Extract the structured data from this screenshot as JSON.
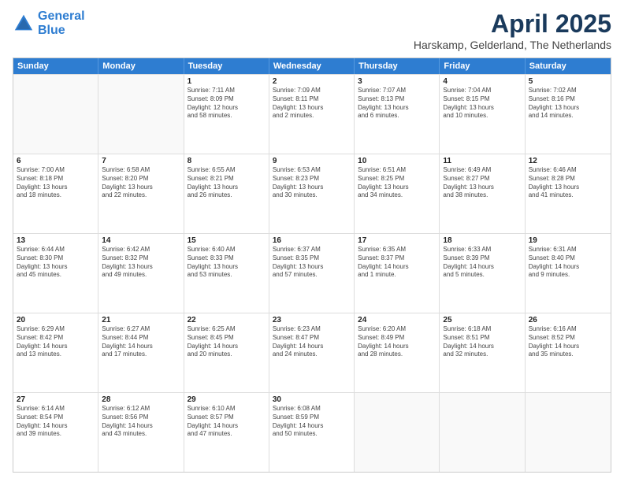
{
  "logo": {
    "line1": "General",
    "line2": "Blue"
  },
  "title": "April 2025",
  "subtitle": "Harskamp, Gelderland, The Netherlands",
  "header_days": [
    "Sunday",
    "Monday",
    "Tuesday",
    "Wednesday",
    "Thursday",
    "Friday",
    "Saturday"
  ],
  "weeks": [
    [
      {
        "day": "",
        "lines": []
      },
      {
        "day": "",
        "lines": []
      },
      {
        "day": "1",
        "lines": [
          "Sunrise: 7:11 AM",
          "Sunset: 8:09 PM",
          "Daylight: 12 hours",
          "and 58 minutes."
        ]
      },
      {
        "day": "2",
        "lines": [
          "Sunrise: 7:09 AM",
          "Sunset: 8:11 PM",
          "Daylight: 13 hours",
          "and 2 minutes."
        ]
      },
      {
        "day": "3",
        "lines": [
          "Sunrise: 7:07 AM",
          "Sunset: 8:13 PM",
          "Daylight: 13 hours",
          "and 6 minutes."
        ]
      },
      {
        "day": "4",
        "lines": [
          "Sunrise: 7:04 AM",
          "Sunset: 8:15 PM",
          "Daylight: 13 hours",
          "and 10 minutes."
        ]
      },
      {
        "day": "5",
        "lines": [
          "Sunrise: 7:02 AM",
          "Sunset: 8:16 PM",
          "Daylight: 13 hours",
          "and 14 minutes."
        ]
      }
    ],
    [
      {
        "day": "6",
        "lines": [
          "Sunrise: 7:00 AM",
          "Sunset: 8:18 PM",
          "Daylight: 13 hours",
          "and 18 minutes."
        ]
      },
      {
        "day": "7",
        "lines": [
          "Sunrise: 6:58 AM",
          "Sunset: 8:20 PM",
          "Daylight: 13 hours",
          "and 22 minutes."
        ]
      },
      {
        "day": "8",
        "lines": [
          "Sunrise: 6:55 AM",
          "Sunset: 8:21 PM",
          "Daylight: 13 hours",
          "and 26 minutes."
        ]
      },
      {
        "day": "9",
        "lines": [
          "Sunrise: 6:53 AM",
          "Sunset: 8:23 PM",
          "Daylight: 13 hours",
          "and 30 minutes."
        ]
      },
      {
        "day": "10",
        "lines": [
          "Sunrise: 6:51 AM",
          "Sunset: 8:25 PM",
          "Daylight: 13 hours",
          "and 34 minutes."
        ]
      },
      {
        "day": "11",
        "lines": [
          "Sunrise: 6:49 AM",
          "Sunset: 8:27 PM",
          "Daylight: 13 hours",
          "and 38 minutes."
        ]
      },
      {
        "day": "12",
        "lines": [
          "Sunrise: 6:46 AM",
          "Sunset: 8:28 PM",
          "Daylight: 13 hours",
          "and 41 minutes."
        ]
      }
    ],
    [
      {
        "day": "13",
        "lines": [
          "Sunrise: 6:44 AM",
          "Sunset: 8:30 PM",
          "Daylight: 13 hours",
          "and 45 minutes."
        ]
      },
      {
        "day": "14",
        "lines": [
          "Sunrise: 6:42 AM",
          "Sunset: 8:32 PM",
          "Daylight: 13 hours",
          "and 49 minutes."
        ]
      },
      {
        "day": "15",
        "lines": [
          "Sunrise: 6:40 AM",
          "Sunset: 8:33 PM",
          "Daylight: 13 hours",
          "and 53 minutes."
        ]
      },
      {
        "day": "16",
        "lines": [
          "Sunrise: 6:37 AM",
          "Sunset: 8:35 PM",
          "Daylight: 13 hours",
          "and 57 minutes."
        ]
      },
      {
        "day": "17",
        "lines": [
          "Sunrise: 6:35 AM",
          "Sunset: 8:37 PM",
          "Daylight: 14 hours",
          "and 1 minute."
        ]
      },
      {
        "day": "18",
        "lines": [
          "Sunrise: 6:33 AM",
          "Sunset: 8:39 PM",
          "Daylight: 14 hours",
          "and 5 minutes."
        ]
      },
      {
        "day": "19",
        "lines": [
          "Sunrise: 6:31 AM",
          "Sunset: 8:40 PM",
          "Daylight: 14 hours",
          "and 9 minutes."
        ]
      }
    ],
    [
      {
        "day": "20",
        "lines": [
          "Sunrise: 6:29 AM",
          "Sunset: 8:42 PM",
          "Daylight: 14 hours",
          "and 13 minutes."
        ]
      },
      {
        "day": "21",
        "lines": [
          "Sunrise: 6:27 AM",
          "Sunset: 8:44 PM",
          "Daylight: 14 hours",
          "and 17 minutes."
        ]
      },
      {
        "day": "22",
        "lines": [
          "Sunrise: 6:25 AM",
          "Sunset: 8:45 PM",
          "Daylight: 14 hours",
          "and 20 minutes."
        ]
      },
      {
        "day": "23",
        "lines": [
          "Sunrise: 6:23 AM",
          "Sunset: 8:47 PM",
          "Daylight: 14 hours",
          "and 24 minutes."
        ]
      },
      {
        "day": "24",
        "lines": [
          "Sunrise: 6:20 AM",
          "Sunset: 8:49 PM",
          "Daylight: 14 hours",
          "and 28 minutes."
        ]
      },
      {
        "day": "25",
        "lines": [
          "Sunrise: 6:18 AM",
          "Sunset: 8:51 PM",
          "Daylight: 14 hours",
          "and 32 minutes."
        ]
      },
      {
        "day": "26",
        "lines": [
          "Sunrise: 6:16 AM",
          "Sunset: 8:52 PM",
          "Daylight: 14 hours",
          "and 35 minutes."
        ]
      }
    ],
    [
      {
        "day": "27",
        "lines": [
          "Sunrise: 6:14 AM",
          "Sunset: 8:54 PM",
          "Daylight: 14 hours",
          "and 39 minutes."
        ]
      },
      {
        "day": "28",
        "lines": [
          "Sunrise: 6:12 AM",
          "Sunset: 8:56 PM",
          "Daylight: 14 hours",
          "and 43 minutes."
        ]
      },
      {
        "day": "29",
        "lines": [
          "Sunrise: 6:10 AM",
          "Sunset: 8:57 PM",
          "Daylight: 14 hours",
          "and 47 minutes."
        ]
      },
      {
        "day": "30",
        "lines": [
          "Sunrise: 6:08 AM",
          "Sunset: 8:59 PM",
          "Daylight: 14 hours",
          "and 50 minutes."
        ]
      },
      {
        "day": "",
        "lines": []
      },
      {
        "day": "",
        "lines": []
      },
      {
        "day": "",
        "lines": []
      }
    ]
  ]
}
